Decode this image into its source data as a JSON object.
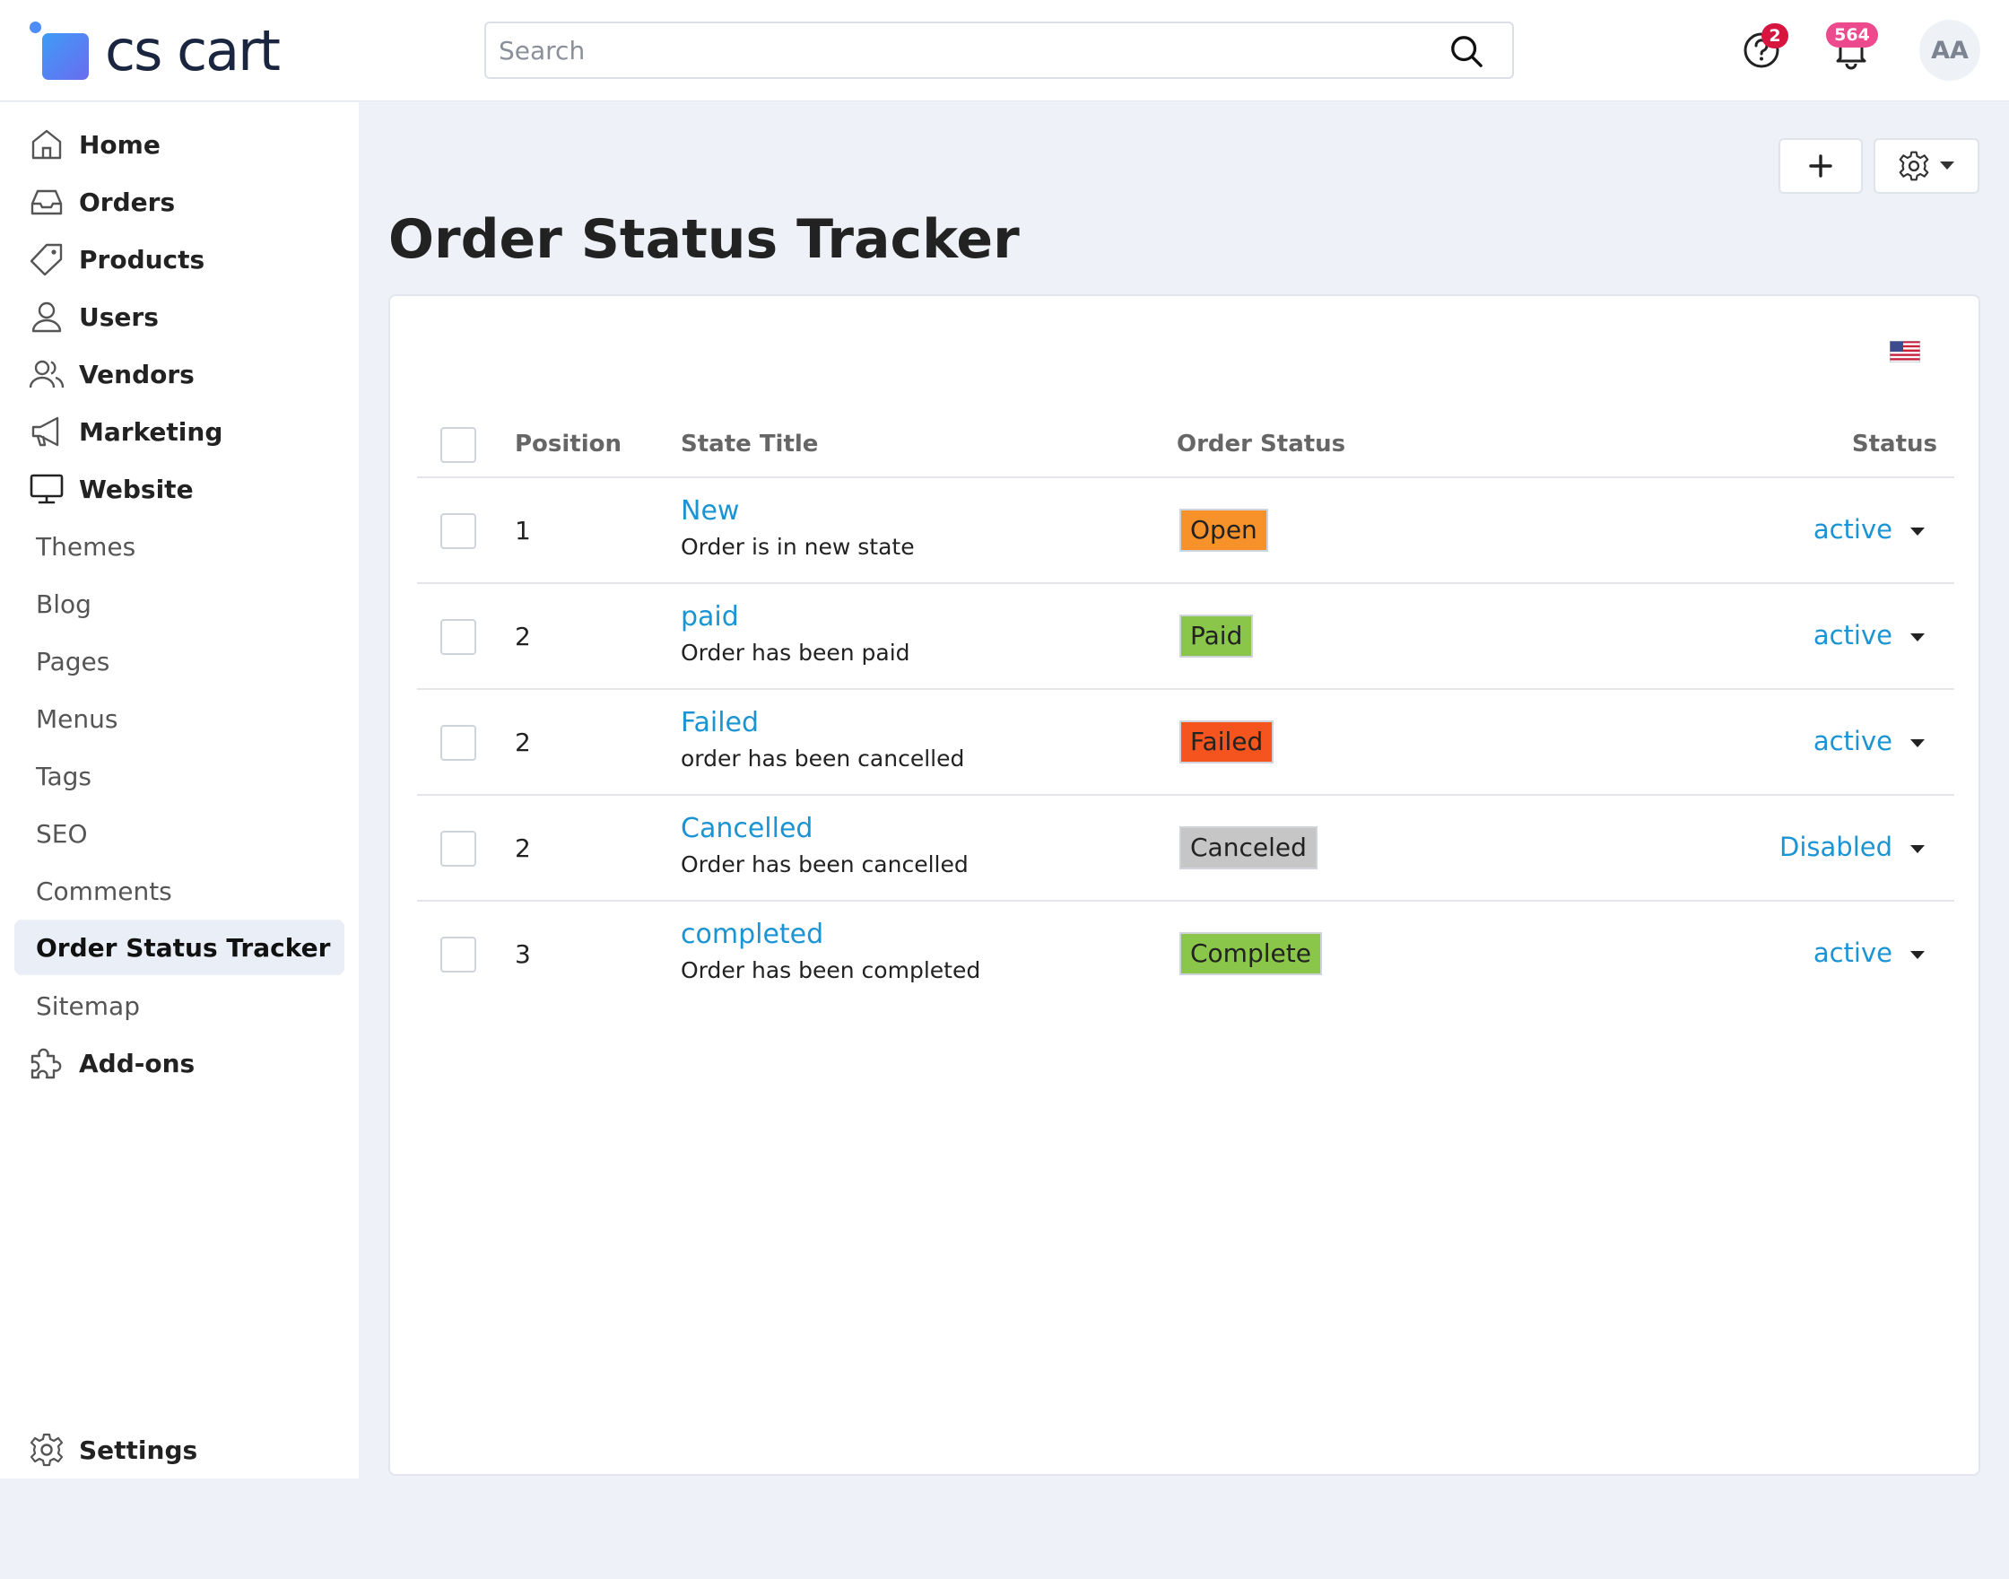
{
  "brand": {
    "name": "cs cart"
  },
  "search": {
    "placeholder": "Search"
  },
  "header": {
    "help_badge": "2",
    "notifications_badge": "564",
    "avatar_initials": "AA"
  },
  "sidebar": {
    "items": [
      {
        "label": "Home",
        "icon": "home-icon"
      },
      {
        "label": "Orders",
        "icon": "inbox-icon"
      },
      {
        "label": "Products",
        "icon": "tag-icon"
      },
      {
        "label": "Users",
        "icon": "user-icon"
      },
      {
        "label": "Vendors",
        "icon": "users-icon"
      },
      {
        "label": "Marketing",
        "icon": "megaphone-icon"
      },
      {
        "label": "Website",
        "icon": "monitor-icon"
      }
    ],
    "website_subitems": [
      "Themes",
      "Blog",
      "Pages",
      "Menus",
      "Tags",
      "SEO",
      "Comments",
      "Order Status Tracker",
      "Sitemap"
    ],
    "addons": "Add-ons",
    "settings": "Settings"
  },
  "page": {
    "title": "Order Status Tracker"
  },
  "table": {
    "headers": {
      "position": "Position",
      "state_title": "State Title",
      "order_status": "Order Status",
      "status": "Status"
    },
    "rows": [
      {
        "position": "1",
        "title": "New",
        "description": "Order is in new state",
        "order_status": "Open",
        "status_color": "#f7922a",
        "status": "active"
      },
      {
        "position": "2",
        "title": "paid",
        "description": "Order has been paid",
        "order_status": "Paid",
        "status_color": "#8ac64a",
        "status": "active"
      },
      {
        "position": "2",
        "title": "Failed",
        "description": "order has been cancelled",
        "order_status": "Failed",
        "status_color": "#f5541e",
        "status": "active"
      },
      {
        "position": "2",
        "title": "Cancelled",
        "description": "Order has been cancelled",
        "order_status": "Canceled",
        "status_color": "#c6c6c6",
        "status": "Disabled"
      },
      {
        "position": "3",
        "title": "completed",
        "description": "Order has been completed",
        "order_status": "Complete",
        "status_color": "#8ac64a",
        "status": "active"
      }
    ]
  },
  "colors": {
    "link": "#1b94d3",
    "accent": "#4e8df7",
    "background": "#eef1f8"
  }
}
